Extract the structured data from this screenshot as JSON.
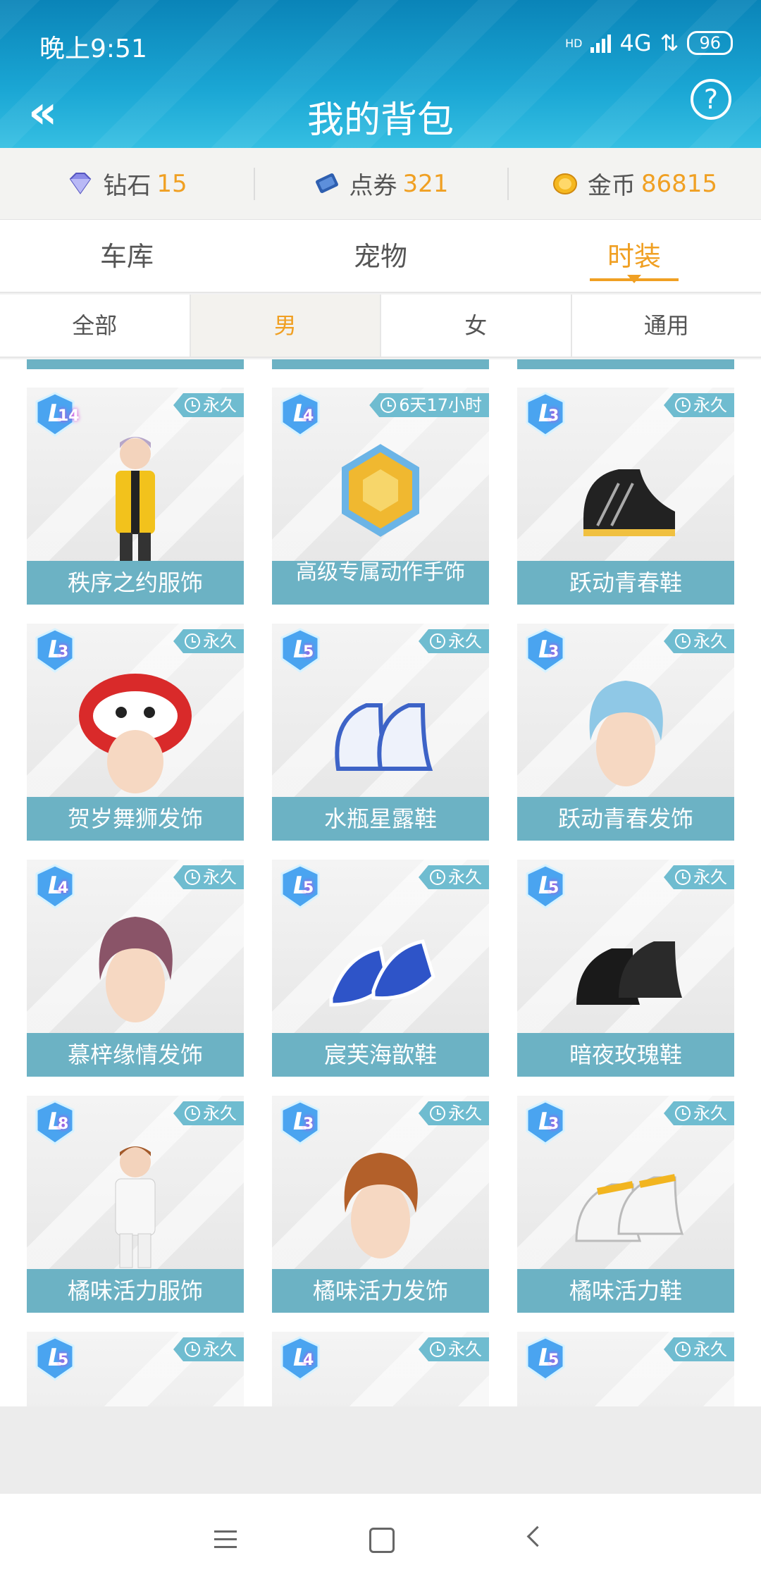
{
  "status_bar": {
    "time": "晚上9:51",
    "signal_label": "HD",
    "network": "4G",
    "battery": "96"
  },
  "header": {
    "title": "我的背包",
    "help_label": "?"
  },
  "currencies": [
    {
      "label": "钻石",
      "value": "15",
      "icon": "diamond-icon",
      "color": "#6f6fd8"
    },
    {
      "label": "点券",
      "value": "321",
      "icon": "coupon-icon",
      "color": "#2e5fb0"
    },
    {
      "label": "金币",
      "value": "86815",
      "icon": "gold-coin-icon",
      "color": "#f0b020"
    }
  ],
  "tabs": [
    {
      "label": "车库",
      "active": false
    },
    {
      "label": "宠物",
      "active": false
    },
    {
      "label": "时装",
      "active": true
    }
  ],
  "subtabs": [
    {
      "label": "全部",
      "active": false
    },
    {
      "label": "男",
      "active": true
    },
    {
      "label": "女",
      "active": false
    },
    {
      "label": "通用",
      "active": false
    }
  ],
  "items": [
    {
      "name": "秩序之约服饰",
      "duration": "永久",
      "level": "14",
      "art": "outfit-yellow"
    },
    {
      "name": "高级专属动作手饰",
      "duration": "6天17小时",
      "level": "4",
      "art": "badge-gold"
    },
    {
      "name": "跃动青春鞋",
      "duration": "永久",
      "level": "3",
      "art": "shoes-black-sport"
    },
    {
      "name": "贺岁舞狮发饰",
      "duration": "永久",
      "level": "3",
      "art": "lion-hat"
    },
    {
      "name": "水瓶星露鞋",
      "duration": "永久",
      "level": "5",
      "art": "shoes-white-blue"
    },
    {
      "name": "跃动青春发饰",
      "duration": "永久",
      "level": "3",
      "art": "hair-blue"
    },
    {
      "name": "慕梓缘情发饰",
      "duration": "永久",
      "level": "4",
      "art": "hair-purple"
    },
    {
      "name": "宸芙海歆鞋",
      "duration": "永久",
      "level": "5",
      "art": "shoes-blue-white"
    },
    {
      "name": "暗夜玫瑰鞋",
      "duration": "永久",
      "level": "5",
      "art": "shoes-black-leather"
    },
    {
      "name": "橘味活力服饰",
      "duration": "永久",
      "level": "8",
      "art": "outfit-white"
    },
    {
      "name": "橘味活力发饰",
      "duration": "永久",
      "level": "3",
      "art": "hair-brown"
    },
    {
      "name": "橘味活力鞋",
      "duration": "永久",
      "level": "3",
      "art": "shoes-yellow-white"
    },
    {
      "name": "",
      "duration": "永久",
      "level": "5",
      "art": "hair-dark"
    },
    {
      "name": "",
      "duration": "永久",
      "level": "4",
      "art": "shoes-white"
    },
    {
      "name": "",
      "duration": "永久",
      "level": "5",
      "art": "accessory-gold"
    }
  ]
}
